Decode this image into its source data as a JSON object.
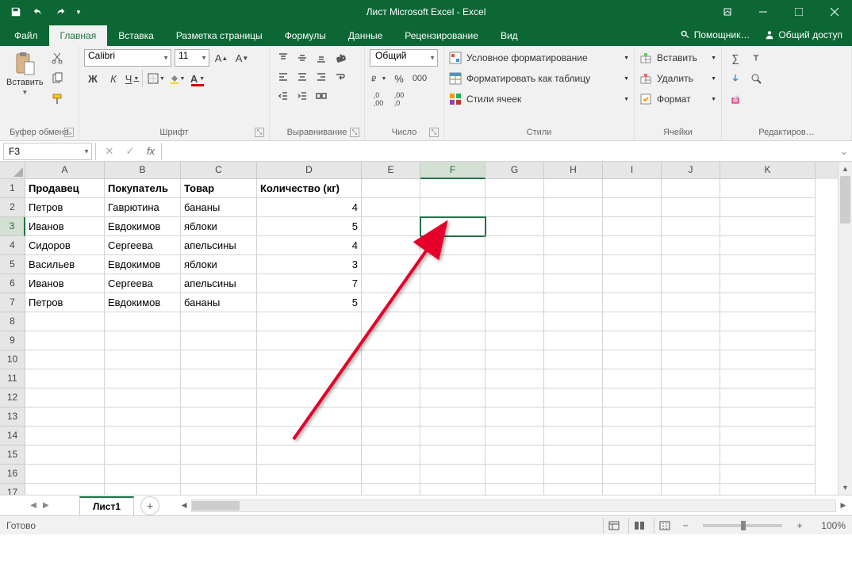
{
  "titlebar": {
    "title": "Лист Microsoft Excel - Excel"
  },
  "tabs": {
    "file": "Файл",
    "home": "Главная",
    "insert": "Вставка",
    "layout": "Разметка страницы",
    "formulas": "Формулы",
    "data": "Данные",
    "review": "Рецензирование",
    "view": "Вид",
    "tellme": "Помощник…",
    "share": "Общий доступ"
  },
  "ribbon": {
    "clipboard": {
      "paste": "Вставить",
      "label": "Буфер обмена"
    },
    "font": {
      "name": "Calibri",
      "size": "11",
      "label": "Шрифт",
      "bold": "Ж",
      "italic": "К",
      "underline": "Ч"
    },
    "align": {
      "label": "Выравнивание"
    },
    "number": {
      "format": "Общий",
      "label": "Число"
    },
    "styles": {
      "cond": "Условное форматирование",
      "table": "Форматировать как таблицу",
      "cell": "Стили ячеек",
      "label": "Стили"
    },
    "cells": {
      "insert": "Вставить",
      "delete": "Удалить",
      "format": "Формат",
      "label": "Ячейки"
    },
    "edit": {
      "label": "Редактиров…"
    }
  },
  "namebox": "F3",
  "columns": [
    "A",
    "B",
    "C",
    "D",
    "E",
    "F",
    "G",
    "H",
    "I",
    "J",
    "K"
  ],
  "visible_rows": 17,
  "active_col": "F",
  "active_row": 3,
  "selected_cell": "F3",
  "headers": [
    "Продавец",
    "Покупатель",
    "Товар",
    "Количество (кг)"
  ],
  "data": [
    [
      "Петров",
      "Гаврютина",
      "бананы",
      "4"
    ],
    [
      "Иванов",
      "Евдокимов",
      "яблоки",
      "5"
    ],
    [
      "Сидоров",
      "Сергеева",
      "апельсины",
      "4"
    ],
    [
      "Васильев",
      "Евдокимов",
      "яблоки",
      "3"
    ],
    [
      "Иванов",
      "Сергеева",
      "апельсины",
      "7"
    ],
    [
      "Петров",
      "Евдокимов",
      "бананы",
      "5"
    ]
  ],
  "sheet": {
    "name": "Лист1"
  },
  "status": {
    "ready": "Готово",
    "zoom": "100%"
  }
}
